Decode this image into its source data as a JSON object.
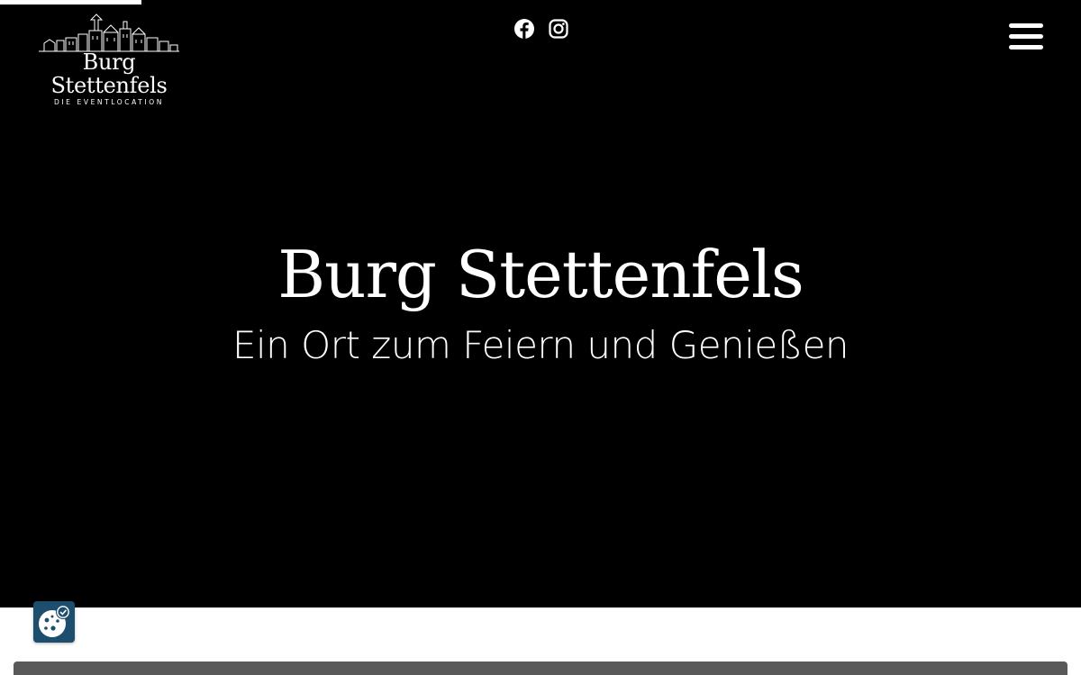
{
  "header": {
    "logo": {
      "title": "Burg Stettenfels",
      "subtitle": "DIE EVENTLOCATION",
      "icon": "castle-icon"
    },
    "social": [
      {
        "name": "facebook",
        "icon": "facebook-icon"
      },
      {
        "name": "instagram",
        "icon": "instagram-icon"
      }
    ],
    "menu_icon": "hamburger-menu-icon"
  },
  "hero": {
    "title": "Burg Stettenfels",
    "subtitle": "Ein Ort zum Feiern und Genießen"
  },
  "cookie": {
    "icon": "cookie-settings-icon"
  },
  "colors": {
    "hero_background": "#000000",
    "text": "#ffffff",
    "cookie_button": "#1e4e6e",
    "content_bar": "#595959"
  }
}
